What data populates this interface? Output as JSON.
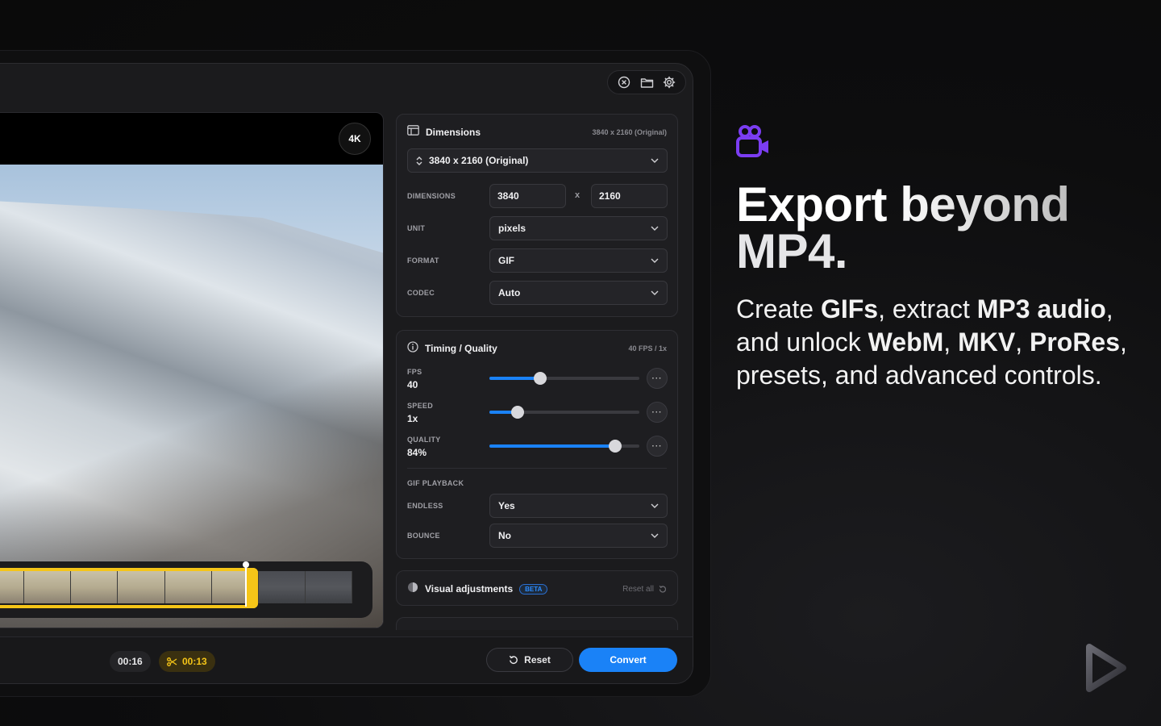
{
  "preview": {
    "resolution_badge": "4K"
  },
  "dimensions_card": {
    "title": "Dimensions",
    "meta": "3840 x 2160 (Original)",
    "preset": "3840 x 2160 (Original)",
    "dimensions_label": "DIMENSIONS",
    "width": "3840",
    "times": "x",
    "height": "2160",
    "unit_label": "UNIT",
    "unit": "pixels",
    "format_label": "FORMAT",
    "format": "GIF",
    "codec_label": "CODEC",
    "codec": "Auto"
  },
  "timing_card": {
    "title": "Timing / Quality",
    "meta": "40 FPS / 1x",
    "fps_label": "FPS",
    "fps_value": "40",
    "fps_fraction": 0.34,
    "speed_label": "SPEED",
    "speed_value": "1x",
    "speed_fraction": 0.19,
    "quality_label": "QUALITY",
    "quality_value": "84%",
    "quality_fraction": 0.84,
    "more_glyph": "···",
    "gif_playback_label": "GIF PLAYBACK",
    "endless_label": "ENDLESS",
    "endless_value": "Yes",
    "bounce_label": "BOUNCE",
    "bounce_value": "No"
  },
  "visual_card": {
    "title": "Visual adjustments",
    "badge": "BETA",
    "reset_all": "Reset all"
  },
  "bottom_bar": {
    "duration": "00:16",
    "trimmed": "00:13",
    "reset_label": "Reset",
    "convert_label": "Convert"
  },
  "promo": {
    "headline_line1": "Export beyond",
    "headline_line2": "MP4.",
    "body": [
      {
        "t": "Create ",
        "b": false
      },
      {
        "t": "GIFs",
        "b": true
      },
      {
        "t": ", extract ",
        "b": false
      },
      {
        "t": "MP3 audio",
        "b": true
      },
      {
        "t": ", and unlock ",
        "b": false
      },
      {
        "t": "WebM",
        "b": true
      },
      {
        "t": ", ",
        "b": false
      },
      {
        "t": "MKV",
        "b": true
      },
      {
        "t": ", ",
        "b": false
      },
      {
        "t": "ProRes",
        "b": true
      },
      {
        "t": ", presets, and advanced controls.",
        "b": false
      }
    ]
  },
  "colors": {
    "accent_blue": "#1a82f7",
    "trim_yellow": "#f5c518",
    "camera_icon_purple": "#7b3df2"
  },
  "icons": [
    "close-circle-icon",
    "folder-icon",
    "gear-icon",
    "layout-icon",
    "chevron-updown-icon",
    "chevron-down-icon",
    "info-icon",
    "palette-icon",
    "undo-icon",
    "scissors-icon",
    "video-camera-icon",
    "app-logo-icon"
  ]
}
